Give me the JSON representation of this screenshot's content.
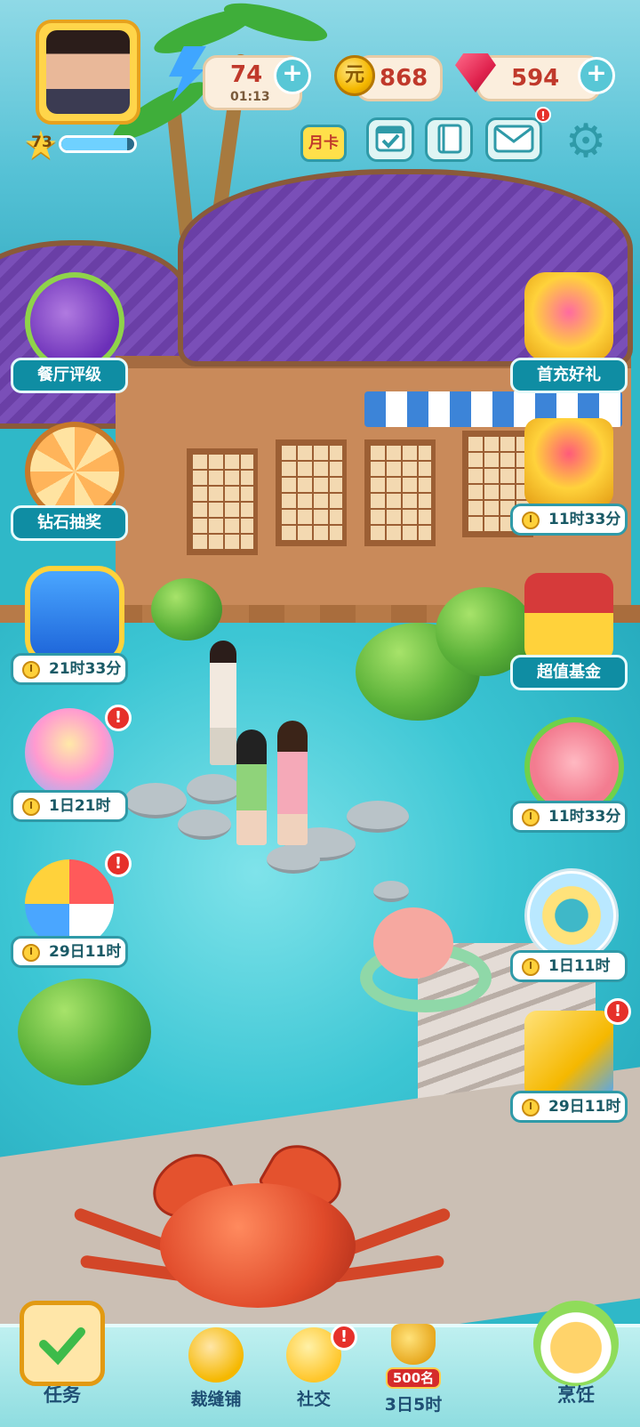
{
  "hud": {
    "player": {
      "level": "73",
      "xp_fraction": 0.9
    },
    "energy": {
      "value": "74",
      "timer": "01:13",
      "icon": "lightning-icon"
    },
    "coins": {
      "value": "868",
      "icon": "coin-icon",
      "symbol": "元"
    },
    "gems": {
      "value": "594",
      "icon": "gem-icon"
    },
    "plus": "+",
    "month_card": "月卡",
    "mail_badge": "!"
  },
  "left_features": [
    {
      "label": "餐厅评级",
      "icon": "spatula-trophy-icon"
    },
    {
      "label": "钻石抽奖",
      "icon": "lottery-wheel-icon"
    },
    {
      "timer": "21时33分",
      "icon": "crown-shield-icon"
    },
    {
      "timer": "1日21时",
      "icon": "balloon-cat-icon",
      "badge": "!"
    },
    {
      "timer": "29日11时",
      "icon": "beach-ball-icon",
      "badge": "!"
    }
  ],
  "right_features": [
    {
      "label": "首充好礼",
      "icon": "gift-pot-icon"
    },
    {
      "timer": "11时33分",
      "icon": "treasure-coins-icon"
    },
    {
      "label": "超值基金",
      "icon": "fund-chest-icon"
    },
    {
      "timer": "11时33分",
      "icon": "piggy-bank-icon"
    },
    {
      "timer": "1日11时",
      "icon": "swim-ring-icon"
    },
    {
      "timer": "29日11时",
      "icon": "ticket-icon",
      "badge": "!"
    }
  ],
  "bottom_nav": {
    "tasks": "任务",
    "tailor": "裁缝铺",
    "social": "社交",
    "social_badge": "!",
    "rank_tag": "500名",
    "event_timer": "3日5时",
    "cooking": "烹饪"
  },
  "colors": {
    "label_bg": "#0f8da3",
    "badge_red": "#e6302a",
    "value_red": "#c0392b"
  }
}
